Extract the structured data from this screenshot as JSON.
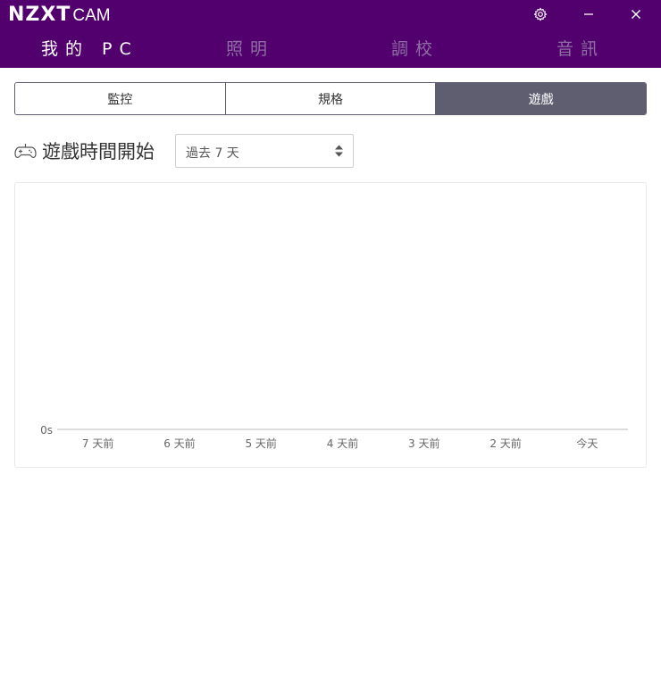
{
  "app": {
    "logo": "NZXT",
    "name": "CAM"
  },
  "window": {
    "settings_icon": "gear-icon",
    "minimize_icon": "minimize-icon",
    "close_icon": "close-icon"
  },
  "nav": {
    "items": [
      {
        "label": "我的 PC",
        "active": true
      },
      {
        "label": "照明",
        "active": false
      },
      {
        "label": "調校",
        "active": false
      },
      {
        "label": "音訊",
        "active": false
      }
    ]
  },
  "tabs": [
    {
      "label": "監控",
      "active": false
    },
    {
      "label": "規格",
      "active": false
    },
    {
      "label": "遊戲",
      "active": true
    }
  ],
  "section": {
    "icon": "gamepad-icon",
    "title": "遊戲時間開始"
  },
  "range_select": {
    "value": "過去 7 天"
  },
  "chart_data": {
    "type": "bar",
    "categories": [
      "7 天前",
      "6 天前",
      "5 天前",
      "4 天前",
      "3 天前",
      "2 天前",
      "今天"
    ],
    "values": [
      0,
      0,
      0,
      0,
      0,
      0,
      0
    ],
    "y_tick_labels": [
      "0s"
    ],
    "title": "",
    "xlabel": "",
    "ylabel": "",
    "grid": false
  },
  "colors": {
    "brand": "#52006e",
    "tab_active": "#5f5d70",
    "nav_inactive": "#8d6fa3"
  }
}
